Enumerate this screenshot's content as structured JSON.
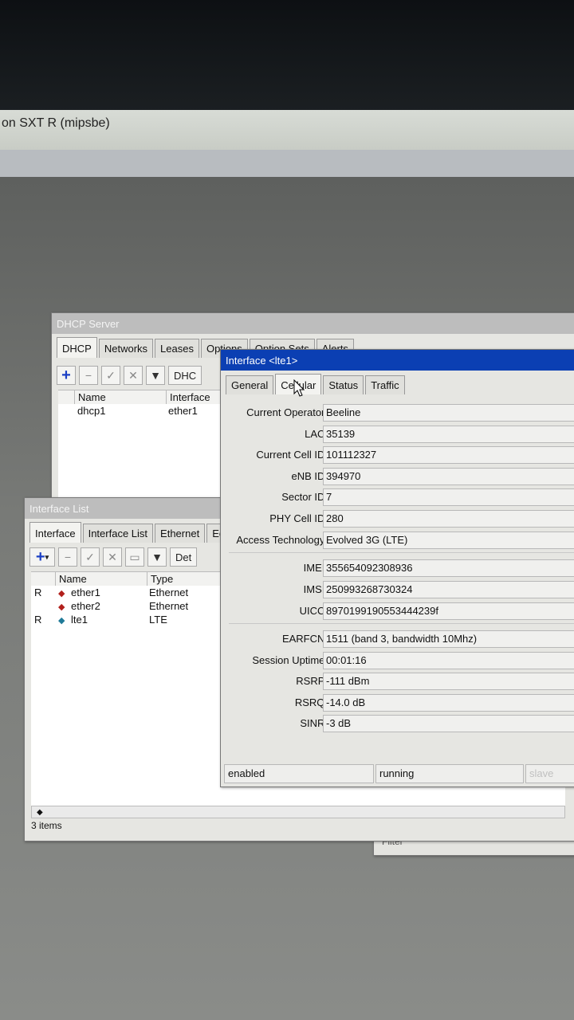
{
  "app_title": "on SXT R (mipsbe)",
  "dhcp_server": {
    "title": "DHCP Server",
    "tabs": [
      "DHCP",
      "Networks",
      "Leases",
      "Options",
      "Option Sets",
      "Alerts"
    ],
    "toolbar_extra": "DHC",
    "columns": [
      "Name",
      "Interface"
    ],
    "rows": [
      {
        "name": "dhcp1",
        "interface": "ether1"
      }
    ],
    "footer_partial": "Filter"
  },
  "interface_list": {
    "title": "Interface List",
    "tabs": [
      "Interface",
      "Interface List",
      "Ethernet",
      "Eo"
    ],
    "toolbar_extra": "Det",
    "columns": [
      "Name",
      "Type"
    ],
    "rows": [
      {
        "flag": "R",
        "icon": "ethernet-icon",
        "name": "ether1",
        "type": "Ethernet"
      },
      {
        "flag": "",
        "icon": "ethernet-icon",
        "name": "ether2",
        "type": "Ethernet"
      },
      {
        "flag": "R",
        "icon": "lte-icon",
        "name": "lte1",
        "type": "LTE"
      }
    ],
    "scroll_marker": "◆",
    "count": "3 items"
  },
  "lte_window": {
    "title": "Interface <lte1>",
    "tabs": [
      "General",
      "Cellular",
      "Status",
      "Traffic"
    ],
    "selected_tab": "Cellular",
    "fields": [
      {
        "label": "Current Operator:",
        "value": "Beeline"
      },
      {
        "label": "LAC:",
        "value": "35139"
      },
      {
        "label": "Current Cell ID:",
        "value": "101112327"
      },
      {
        "label": "eNB ID:",
        "value": "394970"
      },
      {
        "label": "Sector ID:",
        "value": "7"
      },
      {
        "label": "PHY Cell ID:",
        "value": "280"
      },
      {
        "label": "Access Technology:",
        "value": "Evolved 3G (LTE)"
      },
      {
        "label": "IMEI:",
        "value": "355654092308936"
      },
      {
        "label": "IMSI:",
        "value": "250993268730324"
      },
      {
        "label": "UICC:",
        "value": "8970199190553444239f"
      },
      {
        "label": "EARFCN:",
        "value": "1511 (band 3, bandwidth 10Mhz)"
      },
      {
        "label": "Session Uptime:",
        "value": "00:01:16"
      },
      {
        "label": "RSRP:",
        "value": "-111 dBm"
      },
      {
        "label": "RSRQ:",
        "value": "-14.0 dB"
      },
      {
        "label": "SINR:",
        "value": "-3 dB"
      }
    ],
    "status": {
      "state": "enabled",
      "run": "running",
      "slave": "slave"
    }
  }
}
